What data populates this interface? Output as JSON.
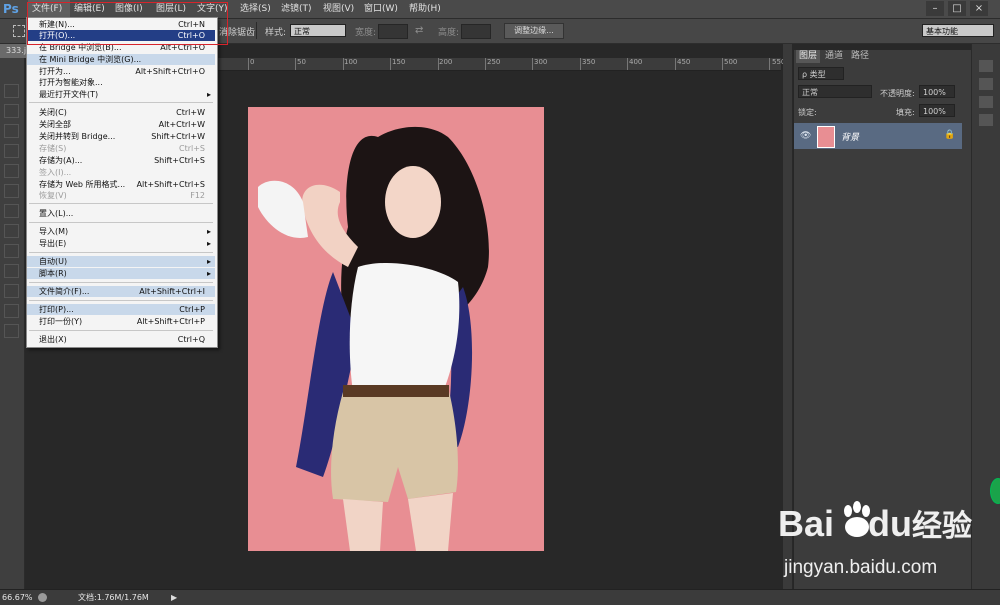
{
  "app": {
    "logo": "Ps"
  },
  "menubar": {
    "items": [
      "文件(F)",
      "编辑(E)",
      "图像(I)",
      "图层(L)",
      "文字(Y)",
      "选择(S)",
      "滤镜(T)",
      "视图(V)",
      "窗口(W)",
      "帮助(H)"
    ],
    "win_controls": [
      "–",
      "□",
      "×"
    ]
  },
  "optionsbar": {
    "antialias_tail": "消除锯齿",
    "style_label": "样式:",
    "style_value": "正常",
    "width_label": "宽度:",
    "height_label": "高度:",
    "refine_edge_button": "调整边缘...",
    "workspace_value": "基本功能"
  },
  "document": {
    "tab_text": "333.j",
    "ruler_labels": [
      "0",
      "50",
      "100",
      "150",
      "200",
      "250",
      "300",
      "350",
      "400",
      "450",
      "500",
      "550"
    ]
  },
  "file_menu": {
    "items": [
      {
        "label": "新建(N)...",
        "shortcut": "Ctrl+N",
        "state": "normal"
      },
      {
        "label": "打开(O)...",
        "shortcut": "Ctrl+O",
        "state": "selected"
      },
      {
        "label": "在 Bridge 中浏览(B)...",
        "shortcut": "Alt+Ctrl+O",
        "state": "normal"
      },
      {
        "label": "在 Mini Bridge 中浏览(G)...",
        "shortcut": "",
        "state": "highlight"
      },
      {
        "label": "打开为...",
        "shortcut": "Alt+Shift+Ctrl+O",
        "state": "normal"
      },
      {
        "label": "打开为智能对象...",
        "shortcut": "",
        "state": "normal"
      },
      {
        "label": "最近打开文件(T)",
        "shortcut": "",
        "state": "normal",
        "submenu": true
      },
      {
        "label": "关闭(C)",
        "shortcut": "Ctrl+W",
        "state": "normal"
      },
      {
        "label": "关闭全部",
        "shortcut": "Alt+Ctrl+W",
        "state": "normal"
      },
      {
        "label": "关闭并转到 Bridge...",
        "shortcut": "Shift+Ctrl+W",
        "state": "normal"
      },
      {
        "label": "存储(S)",
        "shortcut": "Ctrl+S",
        "state": "disabled"
      },
      {
        "label": "存储为(A)...",
        "shortcut": "Shift+Ctrl+S",
        "state": "normal"
      },
      {
        "label": "签入(I)...",
        "shortcut": "",
        "state": "disabled"
      },
      {
        "label": "存储为 Web 所用格式...",
        "shortcut": "Alt+Shift+Ctrl+S",
        "state": "normal"
      },
      {
        "label": "恢复(V)",
        "shortcut": "F12",
        "state": "disabled"
      },
      {
        "label": "置入(L)...",
        "shortcut": "",
        "state": "normal"
      },
      {
        "label": "导入(M)",
        "shortcut": "",
        "state": "normal",
        "submenu": true
      },
      {
        "label": "导出(E)",
        "shortcut": "",
        "state": "normal",
        "submenu": true
      },
      {
        "label": "自动(U)",
        "shortcut": "",
        "state": "highlight",
        "submenu": true
      },
      {
        "label": "脚本(R)",
        "shortcut": "",
        "state": "highlight",
        "submenu": true
      },
      {
        "label": "文件简介(F)...",
        "shortcut": "Alt+Shift+Ctrl+I",
        "state": "highlight"
      },
      {
        "label": "打印(P)...",
        "shortcut": "Ctrl+P",
        "state": "highlight"
      },
      {
        "label": "打印一份(Y)",
        "shortcut": "Alt+Shift+Ctrl+P",
        "state": "normal"
      },
      {
        "label": "退出(X)",
        "shortcut": "Ctrl+Q",
        "state": "normal"
      }
    ]
  },
  "layers_panel": {
    "tabs": [
      "图层",
      "通道",
      "路径"
    ],
    "filter_kind": "ρ 类型",
    "blend_mode": "正常",
    "opacity_label": "不透明度:",
    "opacity_value": "100%",
    "lock_label": "锁定:",
    "fill_label": "填充:",
    "fill_value": "100%",
    "layer_name": "背景"
  },
  "statusbar": {
    "zoom": "66.67%",
    "doc_info": "文档:1.76M/1.76M"
  },
  "watermark": {
    "brand": "Bai",
    "brand_tail": "du",
    "suffix": "经验",
    "url": "jingyan.baidu.com"
  },
  "colors": {
    "menu_selected": "#233e86",
    "menu_highlight": "#c8d8ea",
    "layer_selected": "#596a82",
    "photo_background": "#e88e93",
    "red_annotation": "#d7242b",
    "logo_blue": "#5fa2e6"
  }
}
